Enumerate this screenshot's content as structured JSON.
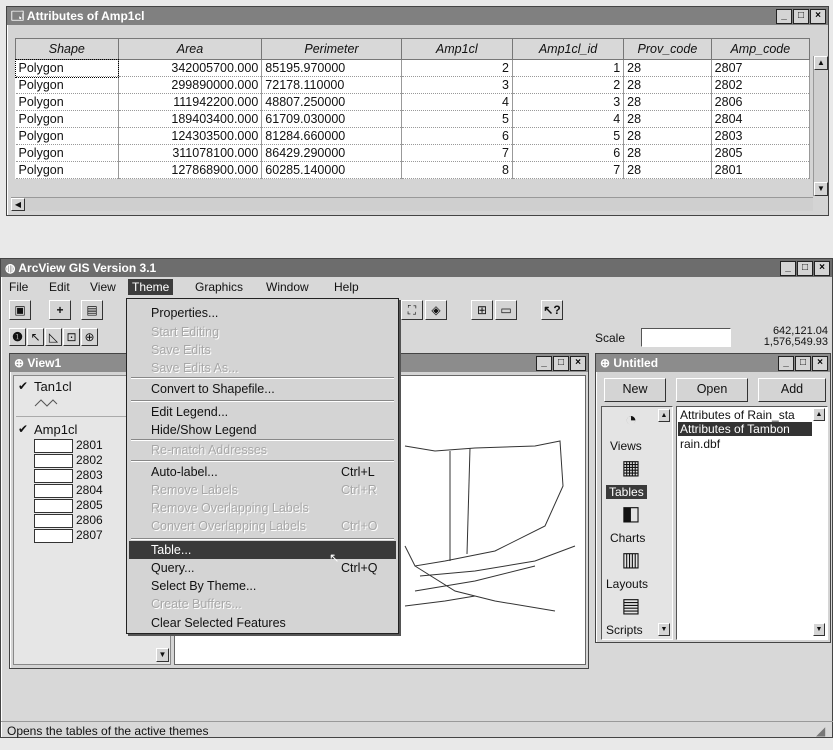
{
  "attr_window": {
    "title": "Attributes of Amp1cl",
    "columns": [
      "Shape",
      "Area",
      "Perimeter",
      "Amp1cl",
      "Amp1cl_id",
      "Prov_code",
      "Amp_code"
    ],
    "rows": [
      [
        "Polygon",
        "342005700.000",
        "85195.970000",
        "2",
        "1",
        "28",
        "2807"
      ],
      [
        "Polygon",
        "299890000.000",
        "72178.110000",
        "3",
        "2",
        "28",
        "2802"
      ],
      [
        "Polygon",
        "111942200.000",
        "48807.250000",
        "4",
        "3",
        "28",
        "2806"
      ],
      [
        "Polygon",
        "189403400.000",
        "61709.030000",
        "5",
        "4",
        "28",
        "2804"
      ],
      [
        "Polygon",
        "124303500.000",
        "81284.660000",
        "6",
        "5",
        "28",
        "2803"
      ],
      [
        "Polygon",
        "311078100.000",
        "86429.290000",
        "7",
        "6",
        "28",
        "2805"
      ],
      [
        "Polygon",
        "127868900.000",
        "60285.140000",
        "8",
        "7",
        "28",
        "2801"
      ]
    ]
  },
  "app": {
    "title": "ArcView GIS Version 3.1",
    "menus": [
      "File",
      "Edit",
      "View",
      "Theme",
      "Graphics",
      "Window",
      "Help"
    ],
    "scale_label": "Scale",
    "coord_x": "642,121.04",
    "coord_y": "1,576,549.93",
    "status": "Opens the tables of the active themes"
  },
  "theme_menu": {
    "items": [
      {
        "label": "Properties...",
        "shortcut": "",
        "enabled": true
      },
      {
        "label": "Start Editing",
        "shortcut": "",
        "enabled": false
      },
      {
        "label": "Save Edits",
        "shortcut": "",
        "enabled": false
      },
      {
        "label": "Save Edits As...",
        "shortcut": "",
        "enabled": false
      },
      {
        "label": "Convert to Shapefile...",
        "shortcut": "",
        "enabled": true
      },
      {
        "label": "Edit Legend...",
        "shortcut": "",
        "enabled": true
      },
      {
        "label": "Hide/Show Legend",
        "shortcut": "",
        "enabled": true
      },
      {
        "label": "Re-match Addresses",
        "shortcut": "",
        "enabled": false
      },
      {
        "label": "Auto-label...",
        "shortcut": "Ctrl+L",
        "enabled": true
      },
      {
        "label": "Remove Labels",
        "shortcut": "Ctrl+R",
        "enabled": false
      },
      {
        "label": "Remove Overlapping Labels",
        "shortcut": "",
        "enabled": false
      },
      {
        "label": "Convert Overlapping Labels",
        "shortcut": "Ctrl+O",
        "enabled": false
      },
      {
        "label": "Table...",
        "shortcut": "",
        "enabled": true,
        "selected": true
      },
      {
        "label": "Query...",
        "shortcut": "Ctrl+Q",
        "enabled": true
      },
      {
        "label": "Select By Theme...",
        "shortcut": "",
        "enabled": true
      },
      {
        "label": "Create Buffers...",
        "shortcut": "",
        "enabled": false
      },
      {
        "label": "Clear Selected Features",
        "shortcut": "",
        "enabled": true
      }
    ]
  },
  "view1": {
    "title": "View1",
    "theme1": "Tan1cl",
    "theme2": "Amp1cl",
    "legend": [
      "2801",
      "2802",
      "2803",
      "2804",
      "2805",
      "2806",
      "2807"
    ]
  },
  "project": {
    "title": "Untitled",
    "btn_new": "New",
    "btn_open": "Open",
    "btn_add": "Add",
    "doc_types": [
      "Views",
      "Tables",
      "Charts",
      "Layouts",
      "Scripts"
    ],
    "docs": [
      "Attributes of Rain_sta",
      "Attributes of Tambon",
      "rain.dbf"
    ]
  }
}
